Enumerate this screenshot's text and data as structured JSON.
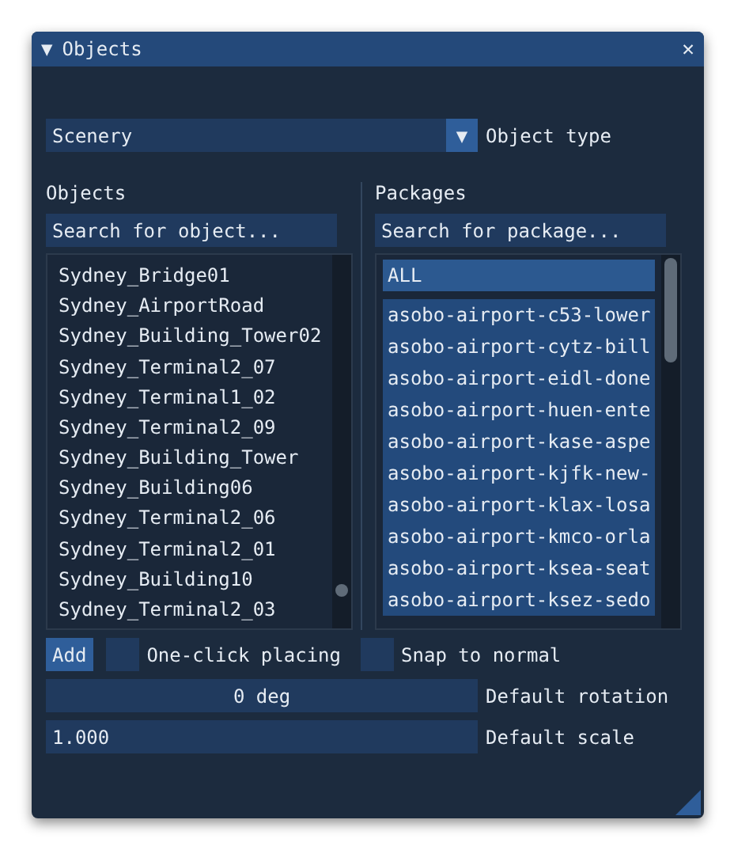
{
  "window": {
    "title": "Objects",
    "collapse_glyph": "▼",
    "close_glyph": "✕"
  },
  "object_type": {
    "value": "Scenery",
    "arrow": "▼",
    "label": "Object type"
  },
  "objects": {
    "heading": "Objects",
    "search": {
      "placeholder": "Search for object..."
    },
    "items": [
      {
        "name": "Sydney_Bridge01",
        "selected": false
      },
      {
        "name": "Sydney_AirportRoad",
        "selected": false
      },
      {
        "name": "Sydney_Building_Tower02",
        "selected": false
      },
      {
        "name": "Sydney_Terminal2_07",
        "selected": false
      },
      {
        "name": "Sydney_Terminal1_02",
        "selected": false
      },
      {
        "name": "Sydney_Terminal2_09",
        "selected": false
      },
      {
        "name": "Sydney_Building_Tower",
        "selected": false
      },
      {
        "name": "Sydney_Building06",
        "selected": false
      },
      {
        "name": "Sydney_Terminal2_06",
        "selected": false
      },
      {
        "name": "Sydney_Terminal2_01",
        "selected": false
      },
      {
        "name": "Sydney_Building10",
        "selected": false
      },
      {
        "name": "Sydney_Terminal2_03",
        "selected": false
      }
    ]
  },
  "packages": {
    "heading": "Packages",
    "search": {
      "placeholder": "Search for package..."
    },
    "items": [
      {
        "name": "ALL",
        "kind": "all",
        "selected": true
      },
      {
        "name": "asobo-airport-c53-lower",
        "kind": "package",
        "selected": true
      },
      {
        "name": "asobo-airport-cytz-bill",
        "kind": "package",
        "selected": true
      },
      {
        "name": "asobo-airport-eidl-done",
        "kind": "package",
        "selected": true
      },
      {
        "name": "asobo-airport-huen-ente",
        "kind": "package",
        "selected": true
      },
      {
        "name": "asobo-airport-kase-aspe",
        "kind": "package",
        "selected": true
      },
      {
        "name": "asobo-airport-kjfk-new-",
        "kind": "package",
        "selected": true
      },
      {
        "name": "asobo-airport-klax-losa",
        "kind": "package",
        "selected": true
      },
      {
        "name": "asobo-airport-kmco-orla",
        "kind": "package",
        "selected": true
      },
      {
        "name": "asobo-airport-ksea-seat",
        "kind": "package",
        "selected": true
      },
      {
        "name": "asobo-airport-ksez-sedo",
        "kind": "package",
        "selected": true
      }
    ]
  },
  "add_button": "Add",
  "options": [
    {
      "label": "One-click placing",
      "checked": false
    },
    {
      "label": "Snap to normal",
      "checked": false
    }
  ],
  "fields": [
    {
      "value": "0 deg",
      "kind": "drag",
      "label": "Default rotation"
    },
    {
      "value": "1.000",
      "kind": "input",
      "label": "Default scale"
    }
  ]
}
